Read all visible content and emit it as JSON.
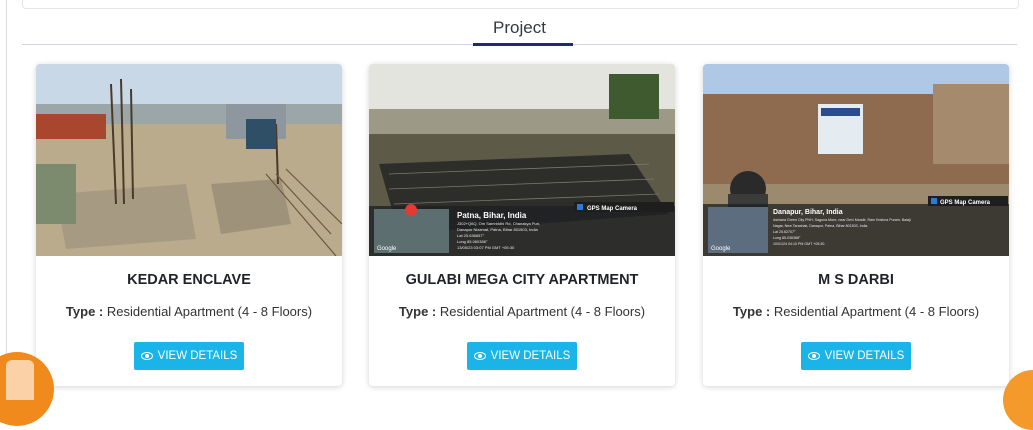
{
  "section": {
    "title": "Project"
  },
  "projects": [
    {
      "name": "KEDAR ENCLAVE",
      "type_label": "Type :",
      "type_value": "Residential Apartment (4 - 8 Floors)",
      "button_label": "VIEW DETAILS"
    },
    {
      "name": "GULABI MEGA CITY APARTMENT",
      "type_label": "Type :",
      "type_value": "Residential Apartment (4 - 8 Floors)",
      "button_label": "VIEW DETAILS",
      "photo_overlay": {
        "badge": "GPS Map Camera",
        "location": "Patna, Bihar, India",
        "address": "J302+Q6Q, Om Samriddhi Rd, Chanakya Puri, Danapur Nizamat, Patna, Bihar 801503, India",
        "lat": "Lat 25.636657°",
        "long": "Long 85.060386°",
        "time": "13/05/23 03:07 PM GMT +05:30",
        "brand": "Google"
      }
    },
    {
      "name": "M S DARBI",
      "type_label": "Type :",
      "type_value": "Residential Apartment (4 - 8 Floors)",
      "button_label": "VIEW DETAILS",
      "photo_overlay": {
        "badge": "GPS Map Camera",
        "location": "Danapur, Bihar, India",
        "address": "Ashiana Green City PHH, Saguna More, near Devi Mandir, Ram Krishna Puram, Balaji Nagar, New Tarachak, Danapur, Patna, Bihar 801503, India",
        "lat": "Lat 25.62707°",
        "long": "Long 85.036388°",
        "time": "10/01/24 04:10 PM GMT +05:30",
        "brand": "Google"
      }
    }
  ],
  "colors": {
    "accent": "#1ab4e8",
    "underline": "#1e2a78",
    "floating": "#f08a1c"
  },
  "icons": {
    "button_icon": "eye-icon"
  }
}
